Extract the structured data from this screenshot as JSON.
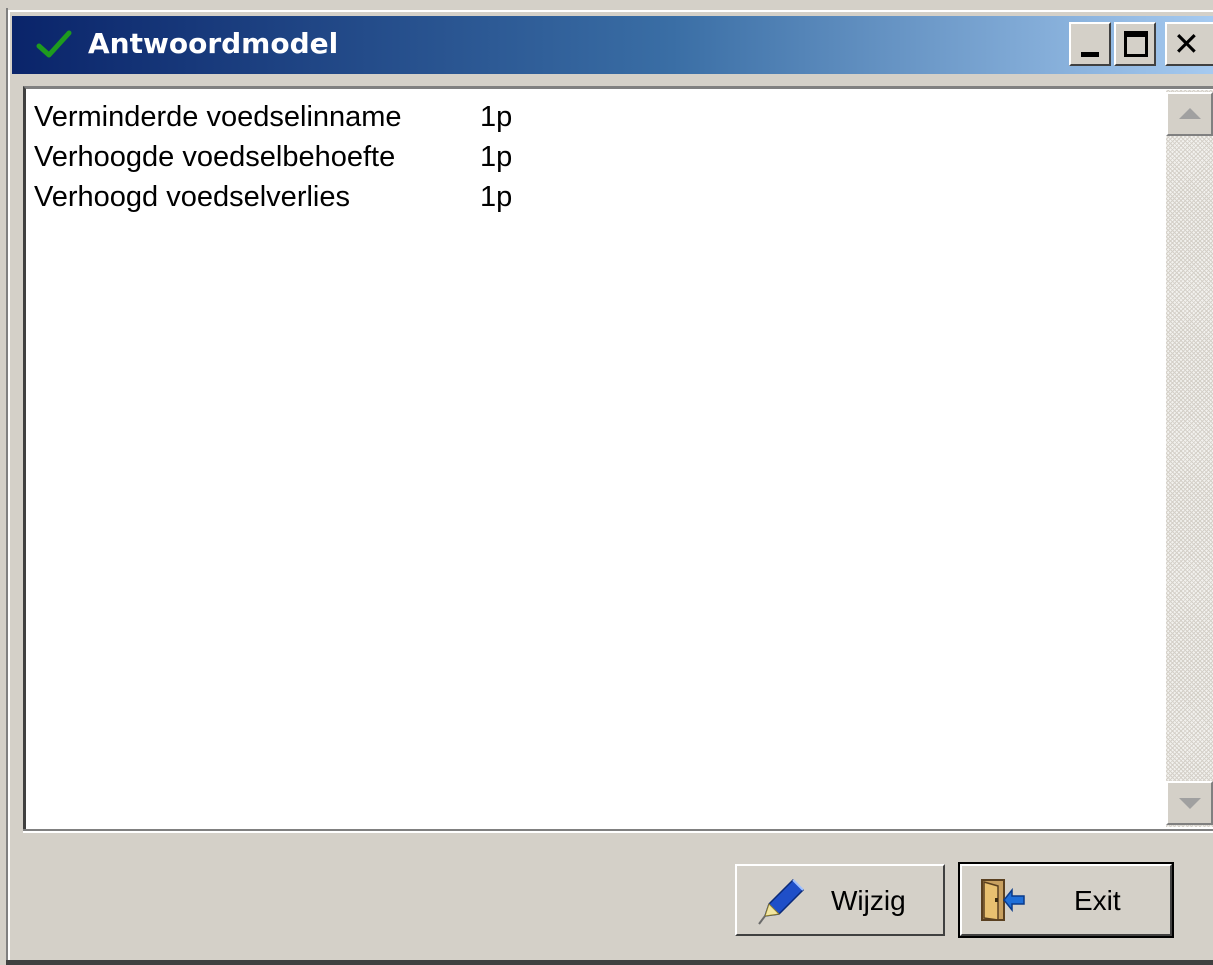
{
  "window": {
    "title": "Antwoordmodel",
    "title_icon": "green-checkmark-icon",
    "colors": {
      "titlebar_start": "#0a246a",
      "titlebar_end": "#a6caf0",
      "face": "#d4d0c8",
      "check": "#1e9b1e"
    }
  },
  "answer_lines": [
    {
      "text": "Verminderde voedselinname",
      "points": "1p"
    },
    {
      "text": "Verhoogde voedselbehoefte",
      "points": "1p"
    },
    {
      "text": "Verhoogd voedselverlies",
      "points": "1p"
    }
  ],
  "buttons": {
    "wijzig": {
      "label": "Wijzig",
      "icon": "pen-icon"
    },
    "exit": {
      "label": "Exit",
      "icon": "exit-door-icon"
    }
  }
}
